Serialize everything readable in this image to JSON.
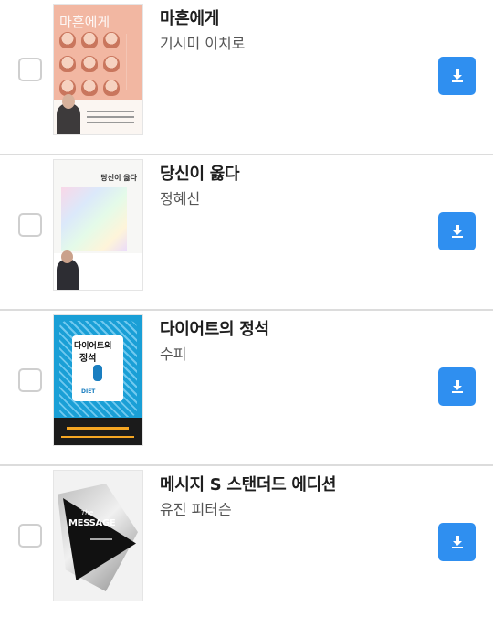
{
  "books": [
    {
      "title": "마흔에게",
      "author": "기시미 이치로",
      "cover_text": "마흔에게",
      "cover_color": "#f2b7a2"
    },
    {
      "title": "당신이 옳다",
      "author": "정혜신",
      "cover_text": "당신이 옳다",
      "cover_color": "#f7f7f5"
    },
    {
      "title": "다이어트의 정석",
      "author": "수피",
      "cover_text_1": "다이어트의",
      "cover_text_2": "정석",
      "cover_text_3": "DIET",
      "cover_color": "#1a9fd6"
    },
    {
      "title": "메시지 S 스탠더드 에디션",
      "author": "유진 피터슨",
      "cover_text_1": "The",
      "cover_text_2": "MESSAGE",
      "cover_color": "#f2f2f2"
    }
  ],
  "colors": {
    "download_button": "#2f8ff0",
    "divider": "#dcdcdc",
    "checkbox_border": "#cfcfcf"
  },
  "icons": {
    "download": "download-icon",
    "checkbox": "checkbox-unchecked"
  }
}
